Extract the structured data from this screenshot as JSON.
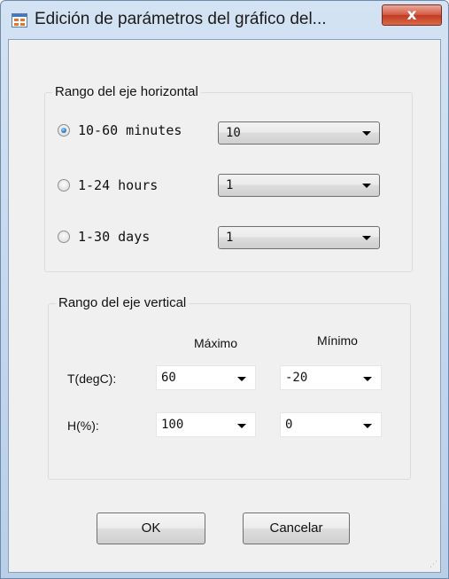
{
  "window": {
    "title": "Edición de parámetros del gráfico del...",
    "icon": "app-window-icon",
    "close_glyph": "x",
    "accent_close": "#c23a22"
  },
  "horizontal_group": {
    "title": "Rango del eje horizontal",
    "options": [
      {
        "label": "10-60 minutes",
        "checked": true,
        "value": "10"
      },
      {
        "label": "1-24 hours",
        "checked": false,
        "value": "1"
      },
      {
        "label": "1-30 days",
        "checked": false,
        "value": "1"
      }
    ]
  },
  "vertical_group": {
    "title": "Rango del eje vertical",
    "col_max": "Máximo",
    "col_min": "Mínimo",
    "rows": [
      {
        "label": "T(degC):",
        "max": "60",
        "min": "-20"
      },
      {
        "label": "H(%):",
        "max": "100",
        "min": "0"
      }
    ]
  },
  "buttons": {
    "ok": "OK",
    "cancel": "Cancelar"
  }
}
